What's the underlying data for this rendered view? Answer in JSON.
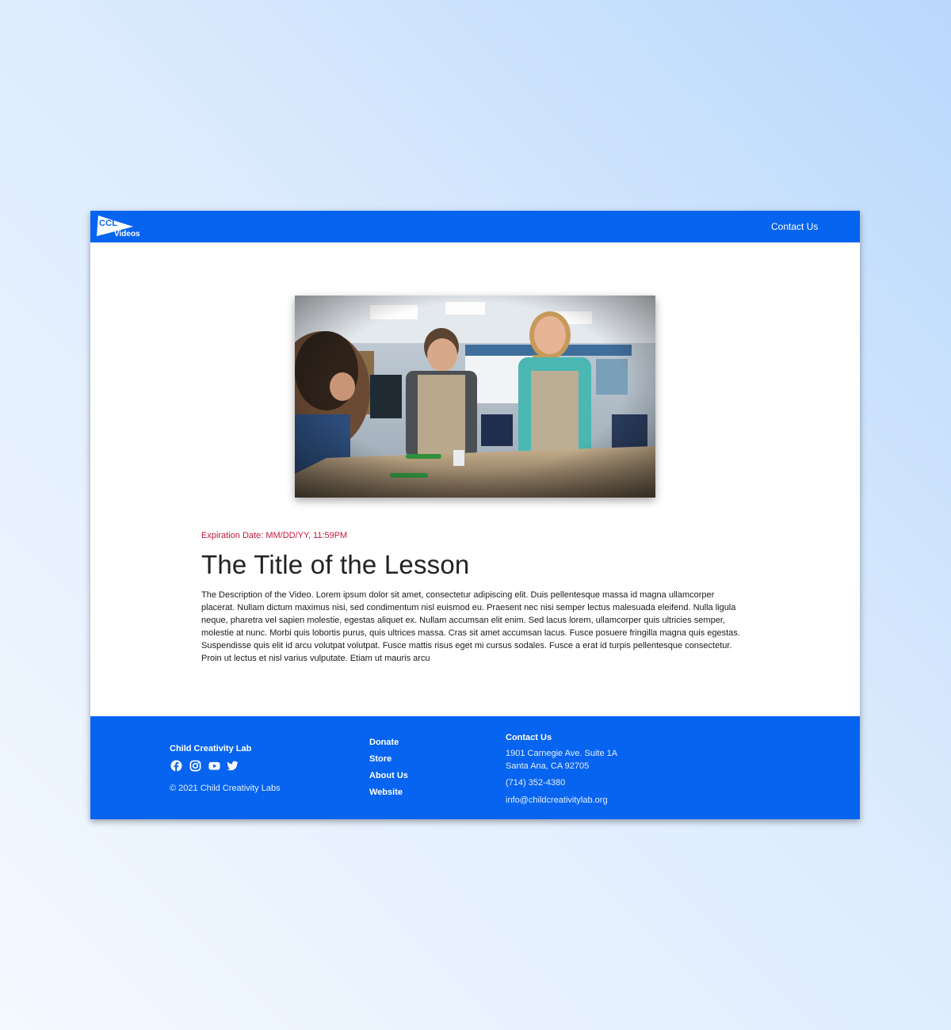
{
  "header": {
    "logo_text": "CCL",
    "logo_subtext": "Videos",
    "contact_link": "Contact Us"
  },
  "colors": {
    "brand_blue": "#0764f0",
    "expiry_red": "#c8163c"
  },
  "lesson": {
    "expiration": "Expiration Date: MM/DD/YY, 11:59PM",
    "title": "The Title of the Lesson",
    "description": "The Description of the Video. Lorem ipsum dolor sit amet, consectetur adipiscing elit. Duis pellentesque massa id magna ullamcorper placerat. Nullam dictum maximus nisi, sed condimentum nisl euismod eu. Praesent nec nisi semper lectus malesuada eleifend. Nulla ligula neque, pharetra vel sapien molestie, egestas aliquet ex. Nullam accumsan elit enim. Sed lacus lorem, ullamcorper quis ultricies semper, molestie at nunc. Morbi quis lobortis purus, quis ultrices massa. Cras sit amet accumsan lacus. Fusce posuere fringilla magna quis egestas. Suspendisse quis elit id arcu volutpat volutpat. Fusce mattis risus eget mi cursus sodales. Fusce a erat id turpis pellentesque consectetur. Proin ut lectus et nisl varius vulputate. Etiam ut mauris arcu"
  },
  "video": {
    "icon": "video-thumbnail"
  },
  "footer": {
    "org_name": "Child Creativity Lab",
    "socials": [
      "facebook-icon",
      "instagram-icon",
      "youtube-icon",
      "twitter-icon"
    ],
    "copyright": "© 2021 Child Creativity Labs",
    "links": [
      "Donate",
      "Store",
      "About Us",
      "Website"
    ],
    "contact_heading": "Contact Us",
    "address_line1": "1901 Carnegie Ave. Suite 1A",
    "address_line2": "Santa Ana, CA 92705",
    "phone": "(714) 352-4380",
    "email": "info@childcreativitylab.org"
  }
}
